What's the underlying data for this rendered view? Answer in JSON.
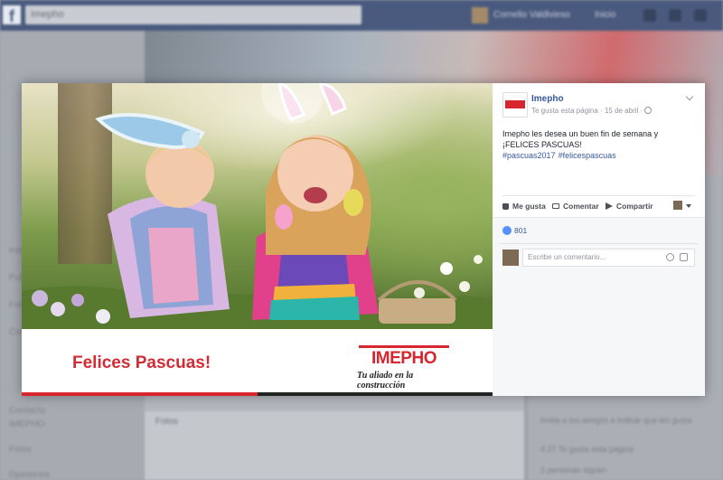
{
  "topbar": {
    "logo": "f",
    "search_placeholder": "Imepho",
    "user_name": "Cornelio Valdivieso",
    "home_label": "Inicio"
  },
  "background_page": {
    "left_items": [
      "Inicio",
      "Publicaciones",
      "Fotos",
      "Comunidad",
      "Contacto",
      "IMEPHO",
      "Fotos",
      "Opiniones"
    ],
    "section_fotos": "Fotos",
    "side_lines": [
      "Invita a tus amigos a indicar que les gusta",
      "4.27 Te gusta esta página",
      "2 personas siguen"
    ]
  },
  "photo": {
    "banner_text": "Felices Pascuas!",
    "logo_text": "IMEPHO",
    "slogan": "Tu aliado en la construcción",
    "progress_fraction": 0.5
  },
  "post": {
    "page_name": "Imepho",
    "meta": "Te gusta esta página · 15 de abril ·",
    "text_line1": "Imepho les desea un buen fin de semana y",
    "text_line2": "¡FELICES PASCUAS!",
    "hashtags": [
      "#pascuas2017",
      "#felicespascuas"
    ],
    "actions": {
      "like": "Me gusta",
      "comment": "Comentar",
      "share": "Compartir"
    },
    "reaction_count": "801",
    "comment_placeholder": "Escribe un comentario..."
  },
  "colors": {
    "brand_red": "#d8262f",
    "fb_blue": "#365899",
    "fb_topbar": "#4a5a7e"
  }
}
